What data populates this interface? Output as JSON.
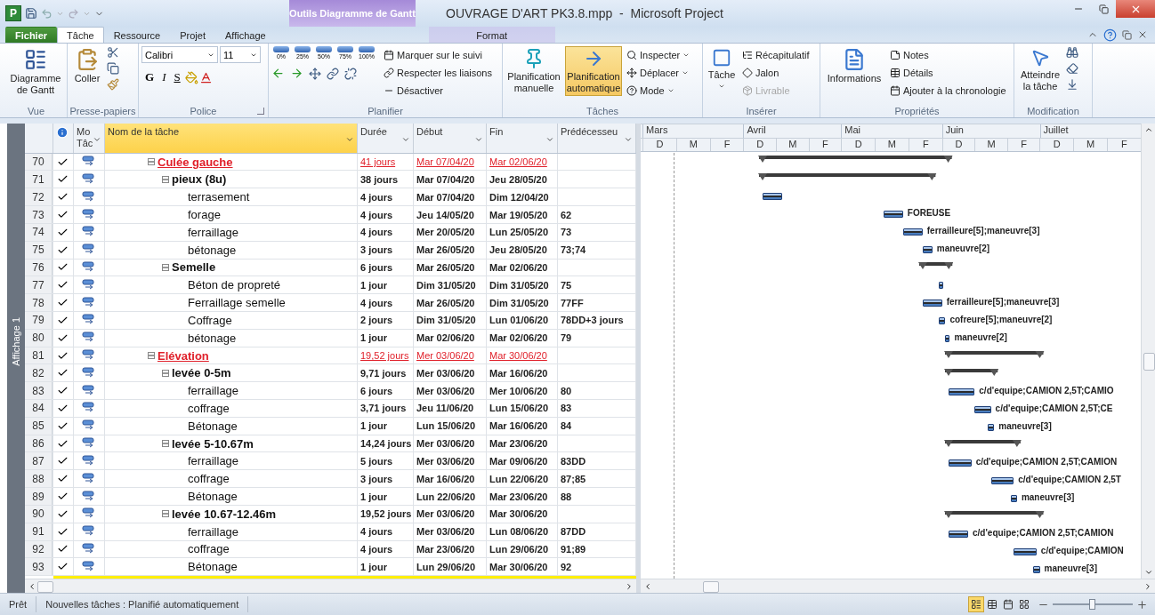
{
  "title_bar": {
    "app_logo": "P",
    "title": "OUVRAGE D'ART PK3.8.mpp  -  Microsoft Project",
    "context_group": "Outils Diagramme de Gantt"
  },
  "ribbon_tabs": [
    {
      "label": "Fichier",
      "kind": "file",
      "selected": false
    },
    {
      "label": "Tâche",
      "kind": "tab",
      "selected": true
    },
    {
      "label": "Ressource",
      "kind": "tab",
      "selected": false
    },
    {
      "label": "Projet",
      "kind": "tab",
      "selected": false
    },
    {
      "label": "Affichage",
      "kind": "tab",
      "selected": false
    },
    {
      "label": "Format",
      "kind": "context",
      "selected": false
    }
  ],
  "ribbon": {
    "vue": {
      "label": "Vue",
      "gantt_button": "Diagramme de Gantt"
    },
    "clipboard": {
      "label": "Presse-papiers",
      "paste": "Coller"
    },
    "font": {
      "label": "Police",
      "font_name": "Calibri",
      "font_size": "11",
      "bold": "G",
      "italic": "I",
      "underline": "S"
    },
    "schedule": {
      "label": "Planifier",
      "percent_buttons": [
        "0%",
        "25%",
        "50%",
        "75%",
        "100%"
      ],
      "commands": [
        "Marquer sur le suivi",
        "Respecter les liaisons",
        "Désactiver"
      ]
    },
    "tasks": {
      "label": "Tâches",
      "modes": [
        {
          "label": "Planification manuelle",
          "selected": false
        },
        {
          "label": "Planification automatique",
          "selected": true
        }
      ],
      "commands": [
        "Inspecter",
        "Déplacer",
        "Mode"
      ]
    },
    "insert": {
      "label": "Insérer",
      "task": "Tâche",
      "commands": [
        {
          "label": "Récapitulatif",
          "disabled": false
        },
        {
          "label": "Jalon",
          "disabled": false
        },
        {
          "label": "Livrable",
          "disabled": true
        }
      ]
    },
    "properties": {
      "label": "Propriétés",
      "info": "Informations",
      "commands": [
        "Notes",
        "Détails",
        "Ajouter à la chronologie"
      ]
    },
    "editing": {
      "label": "Modification",
      "goto": "Atteindre la tâche"
    }
  },
  "view_bar": {
    "label": "Affichage 1"
  },
  "table": {
    "columns": [
      {
        "label": "Mo Tâc",
        "selected": false
      },
      {
        "label": "Nom de la tâche",
        "selected": true
      },
      {
        "label": "Durée",
        "selected": false
      },
      {
        "label": "Début",
        "selected": false
      },
      {
        "label": "Fin",
        "selected": false
      },
      {
        "label": "Prédécesseu",
        "selected": false
      }
    ],
    "rows": [
      {
        "id": "70",
        "name": "Culée gauche",
        "kind": "phase",
        "expanded": true,
        "complete": true,
        "auto_scheduled": true,
        "duration": "41 jours",
        "start": "Mar 07/04/20",
        "finish": "Mar 02/06/20",
        "children": [
          {
            "id": "71",
            "name": "pieux (8u)",
            "kind": "summary",
            "expanded": true,
            "complete": true,
            "auto_scheduled": true,
            "duration": "38 jours",
            "start": "Mar 07/04/20",
            "finish": "Jeu 28/05/20",
            "children": [
              {
                "id": "72",
                "name": "terrasement",
                "kind": "task",
                "complete": true,
                "auto_scheduled": true,
                "duration": "4 jours",
                "start": "Mar 07/04/20",
                "finish": "Dim 12/04/20"
              },
              {
                "id": "73",
                "name": "forage",
                "kind": "task",
                "complete": true,
                "auto_scheduled": true,
                "duration": "4 jours",
                "start": "Jeu 14/05/20",
                "finish": "Mar 19/05/20",
                "predecessors": "62",
                "resources": "FOREUSE"
              },
              {
                "id": "74",
                "name": "ferraillage",
                "kind": "task",
                "complete": true,
                "auto_scheduled": true,
                "duration": "4 jours",
                "start": "Mer 20/05/20",
                "finish": "Lun 25/05/20",
                "predecessors": "73",
                "resources": "ferrailleure[5];maneuvre[3]"
              },
              {
                "id": "75",
                "name": "bétonage",
                "kind": "task",
                "complete": true,
                "auto_scheduled": true,
                "duration": "3 jours",
                "start": "Mar 26/05/20",
                "finish": "Jeu 28/05/20",
                "predecessors": "73;74",
                "resources": "maneuvre[2]"
              }
            ]
          },
          {
            "id": "76",
            "name": "Semelle",
            "kind": "summary",
            "expanded": true,
            "complete": true,
            "auto_scheduled": true,
            "duration": "6 jours",
            "start": "Mar 26/05/20",
            "finish": "Mar 02/06/20",
            "children": [
              {
                "id": "77",
                "name": "Béton de propreté",
                "kind": "task",
                "complete": true,
                "auto_scheduled": true,
                "duration": "1 jour",
                "start": "Dim 31/05/20",
                "finish": "Dim 31/05/20",
                "predecessors": "75"
              },
              {
                "id": "78",
                "name": "Ferraillage semelle",
                "kind": "task",
                "complete": true,
                "auto_scheduled": true,
                "duration": "4 jours",
                "start": "Mar 26/05/20",
                "finish": "Dim 31/05/20",
                "predecessors": "77FF",
                "resources": "ferrailleure[5];maneuvre[3]"
              },
              {
                "id": "79",
                "name": "Coffrage",
                "kind": "task",
                "complete": true,
                "auto_scheduled": true,
                "duration": "2 jours",
                "start": "Dim 31/05/20",
                "finish": "Lun 01/06/20",
                "predecessors": "78DD+3 jours",
                "resources": "cofreure[5];maneuvre[2]"
              },
              {
                "id": "80",
                "name": "bétonage",
                "kind": "task",
                "complete": true,
                "auto_scheduled": true,
                "duration": "1 jour",
                "start": "Mar 02/06/20",
                "finish": "Mar 02/06/20",
                "predecessors": "79",
                "resources": "maneuvre[2]"
              }
            ]
          }
        ]
      },
      {
        "id": "81",
        "name": "Elévation",
        "kind": "phase",
        "expanded": true,
        "complete": true,
        "auto_scheduled": true,
        "duration": "19,52 jours",
        "start": "Mer 03/06/20",
        "finish": "Mar 30/06/20",
        "children": [
          {
            "id": "82",
            "name": "levée 0-5m",
            "kind": "summary",
            "expanded": true,
            "complete": true,
            "auto_scheduled": true,
            "duration": "9,71 jours",
            "start": "Mer 03/06/20",
            "finish": "Mar 16/06/20",
            "children": [
              {
                "id": "83",
                "name": "ferraillage",
                "kind": "task",
                "complete": true,
                "auto_scheduled": true,
                "duration": "6 jours",
                "start": "Mer 03/06/20",
                "finish": "Mer 10/06/20",
                "predecessors": "80",
                "resources": "c/d'equipe;CAMION 2,5T;CAMIO"
              },
              {
                "id": "84",
                "name": "coffrage",
                "kind": "task",
                "complete": true,
                "auto_scheduled": true,
                "duration": "3,71 jours",
                "start": "Jeu 11/06/20",
                "finish": "Lun 15/06/20",
                "predecessors": "83",
                "resources": "c/d'equipe;CAMION 2,5T;CE"
              },
              {
                "id": "85",
                "name": "Bétonage",
                "kind": "task",
                "complete": true,
                "auto_scheduled": true,
                "duration": "1 jour",
                "start": "Lun 15/06/20",
                "finish": "Mar 16/06/20",
                "predecessors": "84",
                "resources": "maneuvre[3]"
              }
            ]
          },
          {
            "id": "86",
            "name": "levée 5-10.67m",
            "kind": "summary",
            "expanded": true,
            "complete": true,
            "auto_scheduled": true,
            "duration": "14,24 jours",
            "start": "Mer 03/06/20",
            "finish": "Mar 23/06/20",
            "children": [
              {
                "id": "87",
                "name": "ferraillage",
                "kind": "task",
                "complete": true,
                "auto_scheduled": true,
                "duration": "5 jours",
                "start": "Mer 03/06/20",
                "finish": "Mar 09/06/20",
                "predecessors": "83DD",
                "resources": "c/d'equipe;CAMION 2,5T;CAMION"
              },
              {
                "id": "88",
                "name": "coffrage",
                "kind": "task",
                "complete": true,
                "auto_scheduled": true,
                "duration": "3 jours",
                "start": "Mar 16/06/20",
                "finish": "Lun 22/06/20",
                "predecessors": "87;85",
                "resources": "c/d'equipe;CAMION 2,5T"
              },
              {
                "id": "89",
                "name": "Bétonage",
                "kind": "task",
                "complete": true,
                "auto_scheduled": true,
                "duration": "1 jour",
                "start": "Lun 22/06/20",
                "finish": "Mar 23/06/20",
                "predecessors": "88",
                "resources": "maneuvre[3]"
              }
            ]
          },
          {
            "id": "90",
            "name": "levée 10.67-12.46m",
            "kind": "summary",
            "expanded": true,
            "complete": true,
            "auto_scheduled": true,
            "duration": "19,52 jours",
            "start": "Mer 03/06/20",
            "finish": "Mar 30/06/20",
            "children": [
              {
                "id": "91",
                "name": "ferraillage",
                "kind": "task",
                "complete": true,
                "auto_scheduled": true,
                "duration": "4 jours",
                "start": "Mer 03/06/20",
                "finish": "Lun 08/06/20",
                "predecessors": "87DD",
                "resources": "c/d'equipe;CAMION 2,5T;CAMION"
              },
              {
                "id": "92",
                "name": "coffrage",
                "kind": "task",
                "complete": true,
                "auto_scheduled": true,
                "duration": "4 jours",
                "start": "Mar 23/06/20",
                "finish": "Lun 29/06/20",
                "predecessors": "91;89",
                "resources": "c/d'equipe;CAMION"
              },
              {
                "id": "93",
                "name": "Bétonage",
                "kind": "task",
                "complete": true,
                "auto_scheduled": true,
                "duration": "1 jour",
                "start": "Lun 29/06/20",
                "finish": "Mar 30/06/20",
                "predecessors": "92",
                "resources": "maneuvre[3]"
              }
            ]
          }
        ]
      }
    ],
    "cut_row": {
      "highlighted": true
    }
  },
  "timescale": [
    {
      "month": "Mars",
      "thirds": [
        "D",
        "M",
        "F"
      ]
    },
    {
      "month": "Avril",
      "thirds": [
        "D",
        "M",
        "F"
      ]
    },
    {
      "month": "Mai",
      "thirds": [
        "D",
        "M",
        "F"
      ]
    },
    {
      "month": "Juin",
      "thirds": [
        "D",
        "M",
        "F"
      ]
    },
    {
      "month": "Juillet",
      "thirds": [
        "D",
        "M",
        "F"
      ]
    }
  ],
  "status_bar": {
    "ready": "Prêt",
    "new_tasks": "Nouvelles tâches : Planifié automatiquement",
    "views": [
      {
        "selected": true
      },
      {
        "selected": false
      },
      {
        "selected": false
      },
      {
        "selected": false
      }
    ],
    "zoom": {
      "level": 0.5
    }
  }
}
